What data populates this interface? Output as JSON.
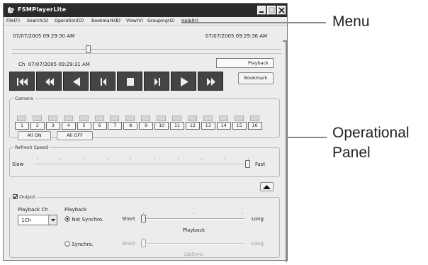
{
  "window": {
    "title": "FSMPlayerLite"
  },
  "menu": [
    "File(F)",
    "Search(S)",
    "Operation(O)",
    "Bookmark(B)",
    "View(V)",
    "Grouping(G)",
    "Help(H)"
  ],
  "timeline": {
    "start": "07/07/2005 09:29:30 AM",
    "end": "07/07/2005 09:29:36 AM",
    "position": 0.28
  },
  "current": {
    "label": "Ch",
    "time": "07/07/2005 09:29:31 AM"
  },
  "mode_label": "Playback",
  "bookmark_label": "Bookmark",
  "controls": [
    "fast-rewind",
    "rewind",
    "reverse-play",
    "step-back",
    "stop",
    "step-forward",
    "play",
    "fast-forward"
  ],
  "camera": {
    "title": "Camera",
    "numbers": [
      "1",
      "2",
      "3",
      "4",
      "5",
      "6",
      "7",
      "8",
      "9",
      "10",
      "11",
      "12",
      "13",
      "14",
      "15",
      "16"
    ],
    "all_on": "All ON",
    "all_off": "All OFF"
  },
  "refresh": {
    "title": "Refresh Speed",
    "min_label": "Slow",
    "max_label": "Fast",
    "level": 1.0
  },
  "output": {
    "title": "Output",
    "checked": true,
    "playback_ch_label": "Playback Ch",
    "playback_ch_value": "1Ch",
    "playback_label": "Playback",
    "not_synchro": "Not Synchro.",
    "synchro": "Synchro.",
    "short": "Short",
    "long": "Long",
    "slider1_caption": "Playback",
    "slider2_caption": "LipSync",
    "slider1_level": 0.0,
    "slider2_level": 0.0
  },
  "callouts": {
    "menu": "Menu",
    "panel_line1": "Operational",
    "panel_line2": "Panel"
  },
  "colors": {
    "titlebar": "#2b2b2b",
    "control_button": "#444444",
    "window_bg": "#ececec"
  }
}
